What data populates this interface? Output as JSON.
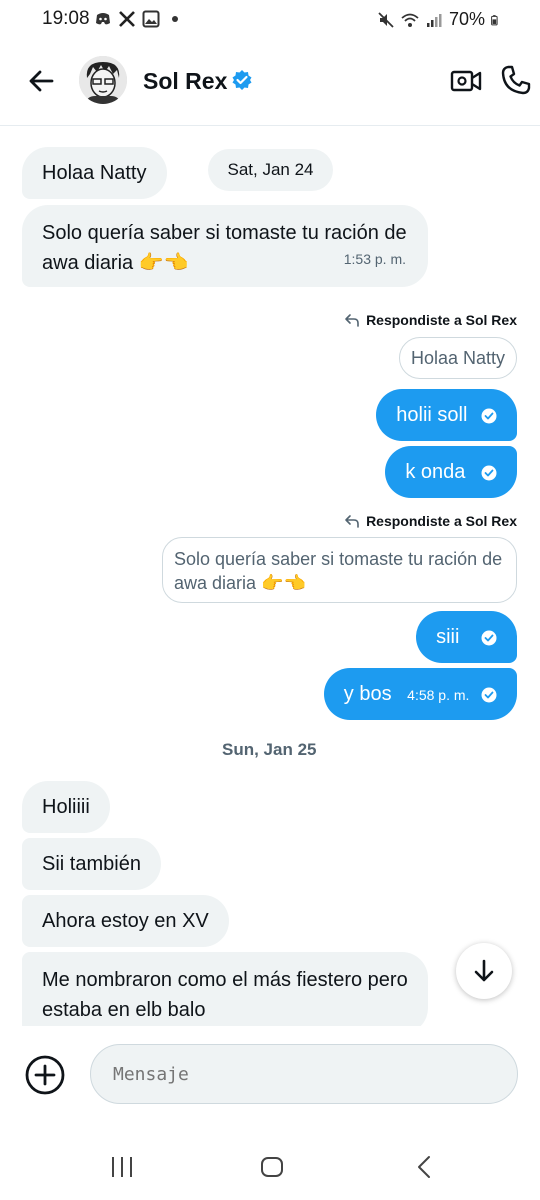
{
  "status_bar": {
    "time": "19:08",
    "battery": "70%"
  },
  "header": {
    "contact_name": "Sol Rex"
  },
  "conversation": {
    "date_1": "Sat, Jan 24",
    "date_2": "Sun, Jan 25",
    "replied_label": "Respondiste a Sol Rex",
    "msg_in_1": "Holaa Natty",
    "msg_in_2": "Solo quería saber si tomaste tu ración de awa diaria 👉👈",
    "msg_in_2_time": "1:53 p. m.",
    "quote_1": "Holaa Natty",
    "msg_out_1": "holii soll",
    "msg_out_2": "k onda",
    "quote_2": "Solo quería saber si tomaste tu ración de awa diaria 👉👈",
    "msg_out_3": "siii",
    "msg_out_4": "y bos",
    "msg_out_4_time": "4:58 p. m.",
    "msg_in_3": "Holiiii",
    "msg_in_4": "Sii también",
    "msg_in_5": "Ahora estoy en XV",
    "msg_in_6": "Me nombraron como el más fiestero pero estaba en elb balo"
  },
  "composer": {
    "placeholder": "Mensaje"
  },
  "colors": {
    "accent": "#1d9bf0",
    "incoming_bg": "#eff3f4",
    "muted_text": "#536471"
  }
}
